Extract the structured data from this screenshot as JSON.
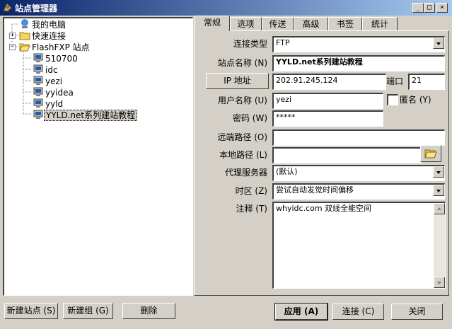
{
  "window": {
    "title": "站点管理器",
    "minimize": "_",
    "maximize": "□",
    "close": "×"
  },
  "tree": {
    "items": [
      {
        "label": "我的电脑"
      },
      {
        "label": "快速连接"
      },
      {
        "label": "FlashFXP 站点"
      },
      {
        "label": "510700"
      },
      {
        "label": "idc"
      },
      {
        "label": "yezi"
      },
      {
        "label": "yyidea"
      },
      {
        "label": "yyld"
      },
      {
        "label": "YYLD.net系列建站教程"
      }
    ]
  },
  "tabs": [
    {
      "label": "常规"
    },
    {
      "label": "选项"
    },
    {
      "label": "传送"
    },
    {
      "label": "高级"
    },
    {
      "label": "书签"
    },
    {
      "label": "统计"
    }
  ],
  "form": {
    "conn_type_label": "连接类型",
    "conn_type_value": "FTP",
    "site_name_label": "站点名称 (N)",
    "site_name_value": "YYLD.net系列建站教程",
    "ip_button": "IP 地址",
    "ip_value": "202.91.245.124",
    "port_label": "端口",
    "port_value": "21",
    "user_label": "用户名称 (U)",
    "user_value": "yezi",
    "anon_label": "匿名 (Y)",
    "password_label": "密码 (W)",
    "password_value": "*****",
    "remote_path_label": "远端路径 (O)",
    "remote_path_value": "",
    "local_path_label": "本地路径 (L)",
    "local_path_value": "",
    "proxy_label": "代理服务器",
    "proxy_value": "(默认)",
    "timezone_label": "时区 (Z)",
    "timezone_value": "尝试自动发觉时间偏移",
    "notes_label": "注释 (T)",
    "notes_value": "whyidc.com 双线全能空间"
  },
  "buttons": {
    "new_site": "新建站点 (S)",
    "new_group": "新建组 (G)",
    "delete": "删除",
    "apply": "应用 (A)",
    "connect": "连接 (C)",
    "close": "关闭"
  }
}
